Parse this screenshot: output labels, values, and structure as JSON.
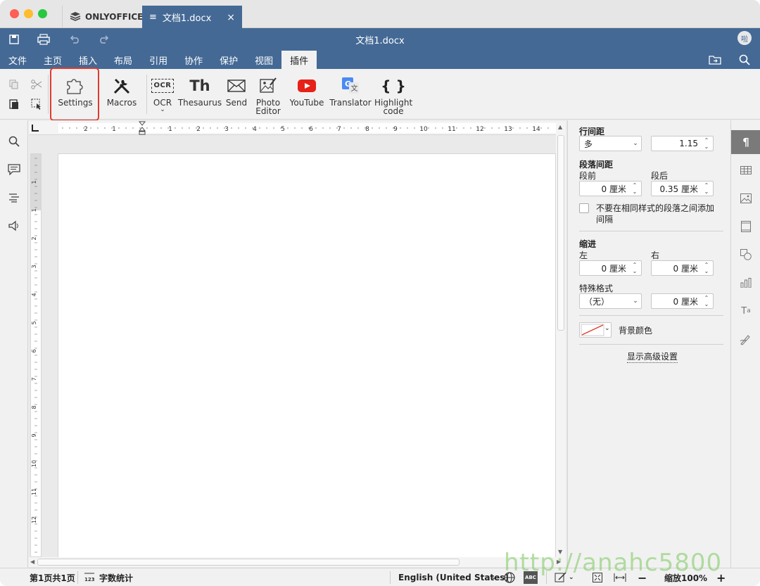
{
  "tabbar": {
    "app_tab": "ONLYOFFICE",
    "doc_tab": "文档1.docx",
    "doc_tab_close": "×"
  },
  "header": {
    "title": "文档1.docx",
    "avatar": "啦",
    "menu": [
      "文件",
      "主页",
      "插入",
      "布局",
      "引用",
      "协作",
      "保护",
      "视图",
      "插件"
    ],
    "active_menu": "插件"
  },
  "toolbar": {
    "plugins": [
      {
        "label": "Settings",
        "icon": "puzzle-icon"
      },
      {
        "label": "Macros",
        "icon": "tools-icon"
      },
      {
        "label": "OCR",
        "icon": "ocr-icon"
      },
      {
        "label": "Thesaurus",
        "icon": "thesaurus-icon"
      },
      {
        "label": "Send",
        "icon": "mail-icon"
      },
      {
        "label": "Photo Editor",
        "icon": "photo-editor-icon"
      },
      {
        "label": "YouTube",
        "icon": "youtube-icon"
      },
      {
        "label": "Translator",
        "icon": "translator-icon"
      },
      {
        "label": "Highlight code",
        "icon": "braces-icon"
      }
    ],
    "ocr_glyph": "OCR",
    "thesaurus_glyph": "Th",
    "braces_glyph": "{ }"
  },
  "ruler": {
    "h_ticks": [
      "2",
      "1",
      "1",
      "2",
      "3",
      "4",
      "5",
      "6",
      "7",
      "8",
      "9",
      "10",
      "11",
      "12",
      "13",
      "14"
    ],
    "v_ticks": [
      "1",
      "1",
      "2",
      "3",
      "4",
      "5",
      "6",
      "7",
      "8",
      "9",
      "10",
      "11",
      "12"
    ]
  },
  "right_panel": {
    "line_spacing_title": "行间距",
    "line_spacing_mode": "多",
    "line_spacing_value": "1.15",
    "para_spacing_title": "段落间距",
    "before_label": "段前",
    "after_label": "段后",
    "before_value": "0 厘米",
    "after_value": "0.35 厘米",
    "no_space_same_style": "不要在相同样式的段落之间添加间隔",
    "indent_title": "缩进",
    "left_label": "左",
    "right_label": "右",
    "left_value": "0 厘米",
    "right_value": "0 厘米",
    "special_title": "特殊格式",
    "special_mode": "（无）",
    "special_value": "0 厘米",
    "bg_color_label": "背景颜色",
    "advanced_link": "显示高级设置"
  },
  "status": {
    "page_info": "第1页共1页",
    "word_count": "字数统计",
    "language": "English (United States)",
    "zoom": "缩放100%"
  },
  "watermark": "http://anahc5800"
}
